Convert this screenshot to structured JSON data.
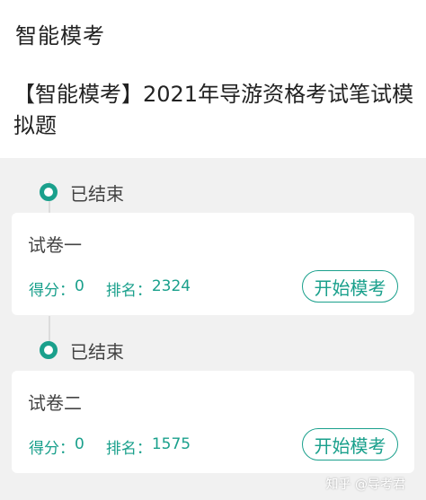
{
  "header": {
    "title": "智能模考"
  },
  "exam": {
    "title": "【智能模考】2021年导游资格考试笔试模拟题"
  },
  "papers": [
    {
      "status": "已结束",
      "name": "试卷一",
      "score_label": "得分：",
      "score": "0",
      "rank_label": "排名：",
      "rank": "2324",
      "button": "开始模考"
    },
    {
      "status": "已结束",
      "name": "试卷二",
      "score_label": "得分：",
      "score": "0",
      "rank_label": "排名：",
      "rank": "1575",
      "button": "开始模考"
    }
  ],
  "watermark": "知乎 @导考君",
  "colors": {
    "accent": "#1aa08c",
    "background": "#f1f1f1",
    "card": "#ffffff"
  }
}
